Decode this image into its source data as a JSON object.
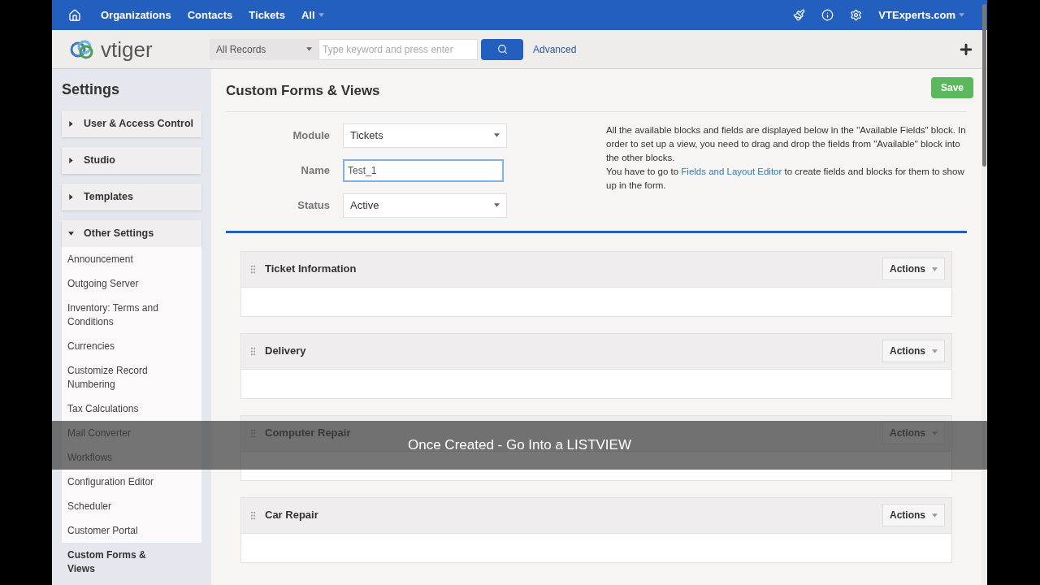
{
  "top_nav": {
    "items": [
      "Organizations",
      "Contacts",
      "Tickets",
      "All"
    ],
    "account": "VTExperts.com"
  },
  "header": {
    "logo": "vtiger",
    "record_filter": "All Records",
    "search": {
      "placeholder": "Type keyword and press enter"
    },
    "advanced": "Advanced"
  },
  "sidebar": {
    "title": "Settings",
    "sections": [
      {
        "label": "User & Access Control",
        "expanded": false
      },
      {
        "label": "Studio",
        "expanded": false
      },
      {
        "label": "Templates",
        "expanded": false
      },
      {
        "label": "Other Settings",
        "expanded": true,
        "children": [
          {
            "label": "Announcement",
            "selected": false
          },
          {
            "label": "Outgoing Server",
            "selected": false
          },
          {
            "label": "Inventory: Terms and Conditions",
            "selected": false
          },
          {
            "label": "Currencies",
            "selected": false
          },
          {
            "label": "Customize Record Numbering",
            "selected": false
          },
          {
            "label": "Tax Calculations",
            "selected": false
          },
          {
            "label": "Mail Converter",
            "selected": false
          },
          {
            "label": "Workflows",
            "selected": false
          },
          {
            "label": "Configuration Editor",
            "selected": false
          },
          {
            "label": "Scheduler",
            "selected": false
          },
          {
            "label": "Customer Portal",
            "selected": false
          },
          {
            "label": "Custom Forms & Views",
            "selected": true
          }
        ]
      }
    ]
  },
  "page": {
    "title": "Custom Forms & Views",
    "save": "Save",
    "form": [
      {
        "label": "Module",
        "kind": "select",
        "value": "Tickets"
      },
      {
        "label": "Name",
        "kind": "text",
        "value": "Test_1"
      },
      {
        "label": "Status",
        "kind": "select",
        "value": "Active"
      }
    ],
    "help": {
      "text1": "All the available blocks and fields are displayed below in the \"Available Fields\" block. In order to set up a view, you need to drag and drop the fields from \"Available\" block into the other blocks.",
      "text2_before": "You have to go to",
      "link": "Fields and Layout Editor",
      "text2_after": "to create fields and blocks for them to show up in the form."
    },
    "blocks": [
      {
        "title": "Ticket Information",
        "actions": "Actions"
      },
      {
        "title": "Delivery",
        "actions": "Actions"
      },
      {
        "title": "Computer Repair",
        "actions": "Actions"
      },
      {
        "title": "Car Repair",
        "actions": "Actions"
      }
    ]
  },
  "video_caption": "Once Created - Go Into a LISTVIEW"
}
